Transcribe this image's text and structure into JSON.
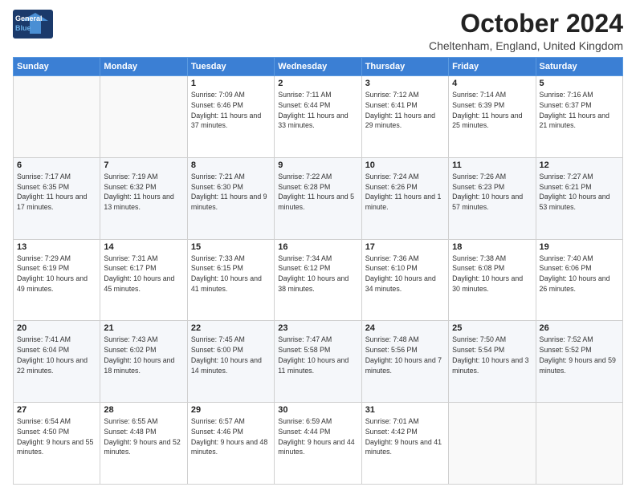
{
  "header": {
    "logo_line1": "General",
    "logo_line2": "Blue",
    "month_title": "October 2024",
    "location": "Cheltenham, England, United Kingdom"
  },
  "weekdays": [
    "Sunday",
    "Monday",
    "Tuesday",
    "Wednesday",
    "Thursday",
    "Friday",
    "Saturday"
  ],
  "weeks": [
    [
      {
        "day": "",
        "info": ""
      },
      {
        "day": "",
        "info": ""
      },
      {
        "day": "1",
        "info": "Sunrise: 7:09 AM\nSunset: 6:46 PM\nDaylight: 11 hours and 37 minutes."
      },
      {
        "day": "2",
        "info": "Sunrise: 7:11 AM\nSunset: 6:44 PM\nDaylight: 11 hours and 33 minutes."
      },
      {
        "day": "3",
        "info": "Sunrise: 7:12 AM\nSunset: 6:41 PM\nDaylight: 11 hours and 29 minutes."
      },
      {
        "day": "4",
        "info": "Sunrise: 7:14 AM\nSunset: 6:39 PM\nDaylight: 11 hours and 25 minutes."
      },
      {
        "day": "5",
        "info": "Sunrise: 7:16 AM\nSunset: 6:37 PM\nDaylight: 11 hours and 21 minutes."
      }
    ],
    [
      {
        "day": "6",
        "info": "Sunrise: 7:17 AM\nSunset: 6:35 PM\nDaylight: 11 hours and 17 minutes."
      },
      {
        "day": "7",
        "info": "Sunrise: 7:19 AM\nSunset: 6:32 PM\nDaylight: 11 hours and 13 minutes."
      },
      {
        "day": "8",
        "info": "Sunrise: 7:21 AM\nSunset: 6:30 PM\nDaylight: 11 hours and 9 minutes."
      },
      {
        "day": "9",
        "info": "Sunrise: 7:22 AM\nSunset: 6:28 PM\nDaylight: 11 hours and 5 minutes."
      },
      {
        "day": "10",
        "info": "Sunrise: 7:24 AM\nSunset: 6:26 PM\nDaylight: 11 hours and 1 minute."
      },
      {
        "day": "11",
        "info": "Sunrise: 7:26 AM\nSunset: 6:23 PM\nDaylight: 10 hours and 57 minutes."
      },
      {
        "day": "12",
        "info": "Sunrise: 7:27 AM\nSunset: 6:21 PM\nDaylight: 10 hours and 53 minutes."
      }
    ],
    [
      {
        "day": "13",
        "info": "Sunrise: 7:29 AM\nSunset: 6:19 PM\nDaylight: 10 hours and 49 minutes."
      },
      {
        "day": "14",
        "info": "Sunrise: 7:31 AM\nSunset: 6:17 PM\nDaylight: 10 hours and 45 minutes."
      },
      {
        "day": "15",
        "info": "Sunrise: 7:33 AM\nSunset: 6:15 PM\nDaylight: 10 hours and 41 minutes."
      },
      {
        "day": "16",
        "info": "Sunrise: 7:34 AM\nSunset: 6:12 PM\nDaylight: 10 hours and 38 minutes."
      },
      {
        "day": "17",
        "info": "Sunrise: 7:36 AM\nSunset: 6:10 PM\nDaylight: 10 hours and 34 minutes."
      },
      {
        "day": "18",
        "info": "Sunrise: 7:38 AM\nSunset: 6:08 PM\nDaylight: 10 hours and 30 minutes."
      },
      {
        "day": "19",
        "info": "Sunrise: 7:40 AM\nSunset: 6:06 PM\nDaylight: 10 hours and 26 minutes."
      }
    ],
    [
      {
        "day": "20",
        "info": "Sunrise: 7:41 AM\nSunset: 6:04 PM\nDaylight: 10 hours and 22 minutes."
      },
      {
        "day": "21",
        "info": "Sunrise: 7:43 AM\nSunset: 6:02 PM\nDaylight: 10 hours and 18 minutes."
      },
      {
        "day": "22",
        "info": "Sunrise: 7:45 AM\nSunset: 6:00 PM\nDaylight: 10 hours and 14 minutes."
      },
      {
        "day": "23",
        "info": "Sunrise: 7:47 AM\nSunset: 5:58 PM\nDaylight: 10 hours and 11 minutes."
      },
      {
        "day": "24",
        "info": "Sunrise: 7:48 AM\nSunset: 5:56 PM\nDaylight: 10 hours and 7 minutes."
      },
      {
        "day": "25",
        "info": "Sunrise: 7:50 AM\nSunset: 5:54 PM\nDaylight: 10 hours and 3 minutes."
      },
      {
        "day": "26",
        "info": "Sunrise: 7:52 AM\nSunset: 5:52 PM\nDaylight: 9 hours and 59 minutes."
      }
    ],
    [
      {
        "day": "27",
        "info": "Sunrise: 6:54 AM\nSunset: 4:50 PM\nDaylight: 9 hours and 55 minutes."
      },
      {
        "day": "28",
        "info": "Sunrise: 6:55 AM\nSunset: 4:48 PM\nDaylight: 9 hours and 52 minutes."
      },
      {
        "day": "29",
        "info": "Sunrise: 6:57 AM\nSunset: 4:46 PM\nDaylight: 9 hours and 48 minutes."
      },
      {
        "day": "30",
        "info": "Sunrise: 6:59 AM\nSunset: 4:44 PM\nDaylight: 9 hours and 44 minutes."
      },
      {
        "day": "31",
        "info": "Sunrise: 7:01 AM\nSunset: 4:42 PM\nDaylight: 9 hours and 41 minutes."
      },
      {
        "day": "",
        "info": ""
      },
      {
        "day": "",
        "info": ""
      }
    ]
  ]
}
